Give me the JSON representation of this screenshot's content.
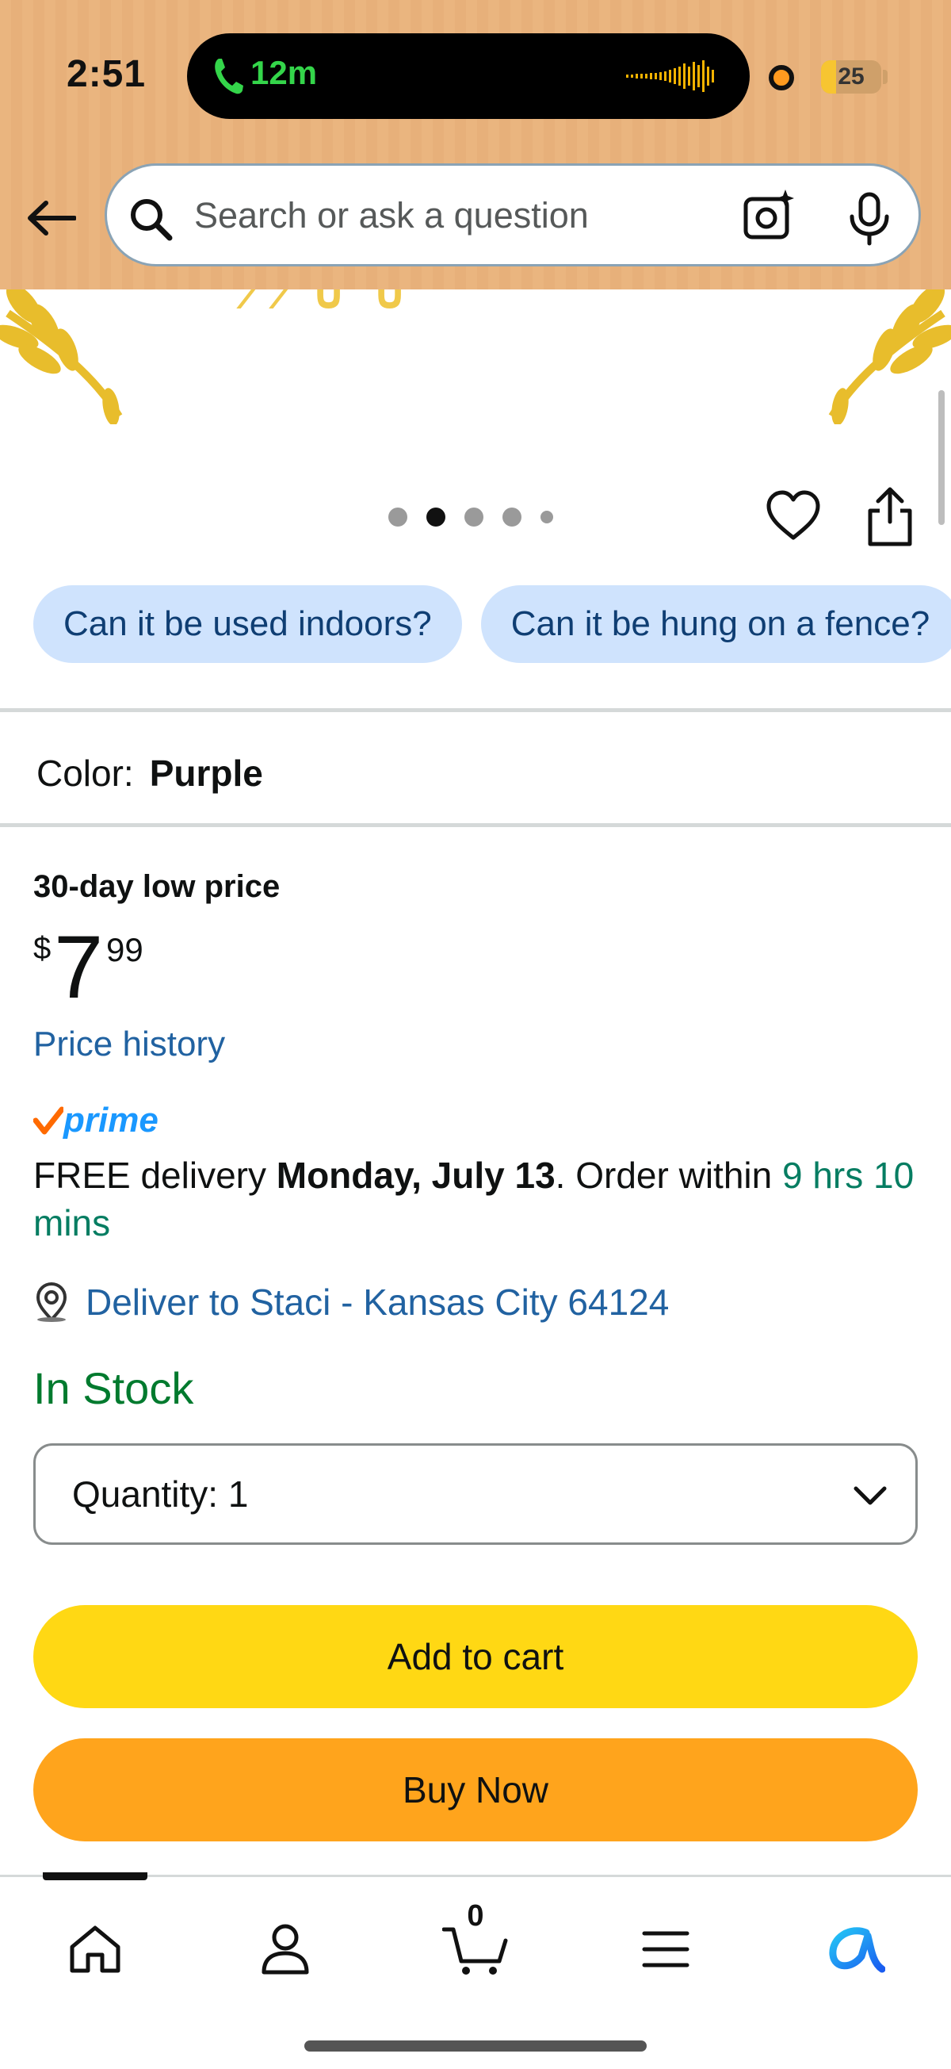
{
  "status_bar": {
    "time": "2:51",
    "call_duration": "12m",
    "battery_level": "25",
    "battery_fraction": 0.25
  },
  "header": {
    "search_placeholder": "Search or ask a question"
  },
  "carousel": {
    "total_images": 5,
    "active_index": 1
  },
  "question_chips": [
    "Can it be used indoors?",
    "Can it be hung on a fence?"
  ],
  "variant": {
    "label": "Color:",
    "value": "Purple"
  },
  "pricing": {
    "badge": "30-day low price",
    "currency_symbol": "$",
    "whole": "7",
    "fraction": "99",
    "history_link": "Price history"
  },
  "delivery": {
    "prime_label": "prime",
    "prefix": "FREE delivery ",
    "date": "Monday, July 13",
    "middle": ". Order within ",
    "countdown": "9 hrs 10 mins",
    "deliver_to": "Deliver to Staci - Kansas City 64124"
  },
  "stock": {
    "status": "In Stock"
  },
  "quantity": {
    "label": "Quantity:",
    "value": "1"
  },
  "actions": {
    "add_to_cart": "Add to cart",
    "buy_now": "Buy Now"
  },
  "bottom_nav": {
    "cart_count": "0",
    "items": [
      "home-icon",
      "account-icon",
      "cart-icon",
      "menu-icon",
      "ai-assistant-icon"
    ]
  },
  "colors": {
    "header_bg": "#eab57f",
    "chip_bg": "#cfe3fd",
    "link": "#2162a1",
    "in_stock": "#007a2e",
    "countdown": "#067d62",
    "add_to_cart_bg": "#ffd814",
    "buy_now_bg": "#ffa41c",
    "prime_blue": "#1a98ff"
  }
}
